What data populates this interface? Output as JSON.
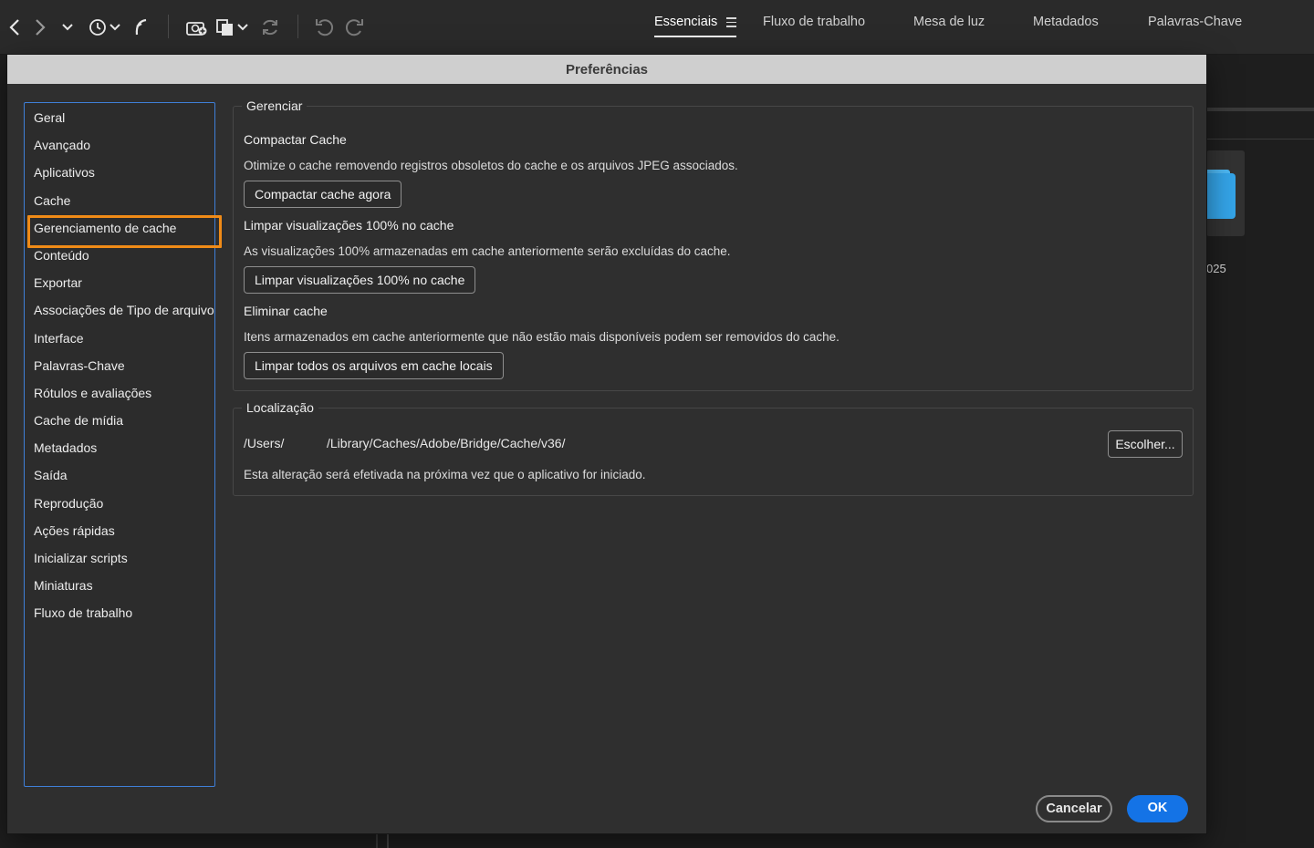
{
  "toolbar": {
    "icons": [
      "back-icon",
      "forward-icon",
      "chevron-down-icon",
      "recent-history-icon",
      "boomerang-icon",
      "camera-import-icon",
      "copy-icon",
      "refresh-icon",
      "undo-icon",
      "redo-icon"
    ],
    "workspaces": [
      {
        "label": "Essenciais",
        "active": true
      },
      {
        "label": "Fluxo de trabalho",
        "active": false
      },
      {
        "label": "Mesa de luz",
        "active": false
      },
      {
        "label": "Metadados",
        "active": false
      },
      {
        "label": "Palavras-Chave",
        "active": false
      }
    ]
  },
  "background": {
    "folder_label": "025"
  },
  "dialog": {
    "title": "Preferências",
    "categories": [
      "Geral",
      "Avançado",
      "Aplicativos",
      "Cache",
      "Gerenciamento de cache",
      "Conteúdo",
      "Exportar",
      "Associações de Tipo de arquivo",
      "Interface",
      "Palavras-Chave",
      "Rótulos e avaliações",
      "Cache de mídia",
      "Metadados",
      "Saída",
      "Reprodução",
      "Ações rápidas",
      "Inicializar scripts",
      "Miniaturas",
      "Fluxo de trabalho"
    ],
    "selected_category": "Gerenciamento de cache",
    "manage": {
      "legend": "Gerenciar",
      "compact_title": "Compactar Cache",
      "compact_desc": "Otimize o cache removendo registros obsoletos do cache e os arquivos JPEG associados.",
      "compact_button": "Compactar cache agora",
      "clear100_title": "Limpar visualizações 100% no cache",
      "clear100_desc": "As visualizações 100% armazenadas em cache anteriormente serão excluídas do cache.",
      "clear100_button": "Limpar visualizações 100% no cache",
      "purge_title": "Eliminar cache",
      "purge_desc": "Itens armazenados em cache anteriormente que não estão mais disponíveis podem ser removidos do cache.",
      "purge_button": "Limpar todos os arquivos em cache locais"
    },
    "location": {
      "legend": "Localização",
      "path_prefix": "/Users/",
      "path_rest": "/Library/Caches/Adobe/Bridge/Cache/v36/",
      "choose_button": "Escolher...",
      "note": "Esta alteração será efetivada na próxima vez que o aplicativo for iniciado."
    },
    "cancel_button": "Cancelar",
    "ok_button": "OK",
    "colors": {
      "accent": "#1473e6",
      "selection": "#f08b17",
      "list_border": "#3f7fd8"
    }
  }
}
